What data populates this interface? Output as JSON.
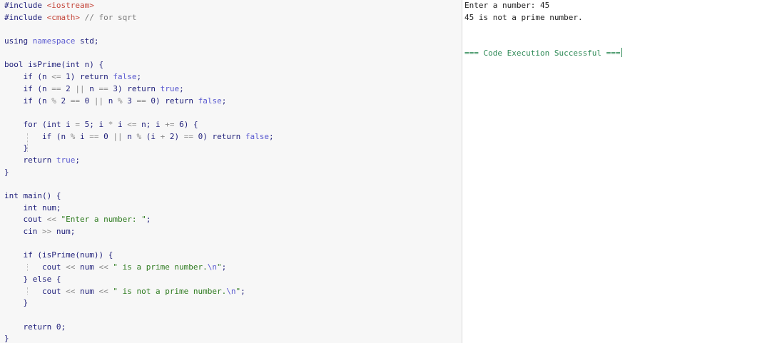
{
  "theme": {
    "editor_bg": "#f7f7f7",
    "output_bg": "#ffffff",
    "plain": "#1f1f7a",
    "keyword": "#1f1f7a",
    "preprocessor": "#1f1f7a",
    "header": "#c4463a",
    "comment": "#7a7a7a",
    "string": "#2d7a1e",
    "literal": "#5a5ad0",
    "operator": "#8a8a8a",
    "success": "#2f8a57"
  },
  "editor": {
    "lines": [
      [
        {
          "t": "#include ",
          "c": "preprocessor"
        },
        {
          "t": "<iostream>",
          "c": "header"
        }
      ],
      [
        {
          "t": "#include ",
          "c": "preprocessor"
        },
        {
          "t": "<cmath>",
          "c": "header"
        },
        {
          "t": " // for sqrt",
          "c": "comment"
        }
      ],
      [],
      [
        {
          "t": "using ",
          "c": "keyword"
        },
        {
          "t": "namespace ",
          "c": "literal"
        },
        {
          "t": "std;",
          "c": "plain"
        }
      ],
      [],
      [
        {
          "t": "bool ",
          "c": "keyword"
        },
        {
          "t": "isPrime(",
          "c": "plain"
        },
        {
          "t": "int ",
          "c": "keyword"
        },
        {
          "t": "n) {",
          "c": "plain"
        }
      ],
      [
        {
          "t": "    if ",
          "c": "keyword"
        },
        {
          "t": "(n ",
          "c": "plain"
        },
        {
          "t": "<=",
          "c": "operator"
        },
        {
          "t": " 1) ",
          "c": "plain"
        },
        {
          "t": "return ",
          "c": "keyword"
        },
        {
          "t": "false",
          "c": "literal"
        },
        {
          "t": ";",
          "c": "plain"
        }
      ],
      [
        {
          "t": "    if ",
          "c": "keyword"
        },
        {
          "t": "(n ",
          "c": "plain"
        },
        {
          "t": "==",
          "c": "operator"
        },
        {
          "t": " 2 ",
          "c": "plain"
        },
        {
          "t": "||",
          "c": "operator"
        },
        {
          "t": " n ",
          "c": "plain"
        },
        {
          "t": "==",
          "c": "operator"
        },
        {
          "t": " 3) ",
          "c": "plain"
        },
        {
          "t": "return ",
          "c": "keyword"
        },
        {
          "t": "true",
          "c": "literal"
        },
        {
          "t": ";",
          "c": "plain"
        }
      ],
      [
        {
          "t": "    if ",
          "c": "keyword"
        },
        {
          "t": "(n ",
          "c": "plain"
        },
        {
          "t": "%",
          "c": "operator"
        },
        {
          "t": " 2 ",
          "c": "plain"
        },
        {
          "t": "==",
          "c": "operator"
        },
        {
          "t": " 0 ",
          "c": "plain"
        },
        {
          "t": "||",
          "c": "operator"
        },
        {
          "t": " n ",
          "c": "plain"
        },
        {
          "t": "%",
          "c": "operator"
        },
        {
          "t": " 3 ",
          "c": "plain"
        },
        {
          "t": "==",
          "c": "operator"
        },
        {
          "t": " 0) ",
          "c": "plain"
        },
        {
          "t": "return ",
          "c": "keyword"
        },
        {
          "t": "false",
          "c": "literal"
        },
        {
          "t": ";",
          "c": "plain"
        }
      ],
      [],
      [
        {
          "t": "    for ",
          "c": "keyword"
        },
        {
          "t": "(",
          "c": "plain"
        },
        {
          "t": "int ",
          "c": "keyword"
        },
        {
          "t": "i ",
          "c": "plain"
        },
        {
          "t": "=",
          "c": "operator"
        },
        {
          "t": " 5; i ",
          "c": "plain"
        },
        {
          "t": "*",
          "c": "operator"
        },
        {
          "t": " i ",
          "c": "plain"
        },
        {
          "t": "<=",
          "c": "operator"
        },
        {
          "t": " n; i ",
          "c": "plain"
        },
        {
          "t": "+=",
          "c": "operator"
        },
        {
          "t": " 6) {",
          "c": "plain"
        }
      ],
      [
        {
          "t": "        if ",
          "c": "keyword"
        },
        {
          "t": "(n ",
          "c": "plain"
        },
        {
          "t": "%",
          "c": "operator"
        },
        {
          "t": " i ",
          "c": "plain"
        },
        {
          "t": "==",
          "c": "operator"
        },
        {
          "t": " 0 ",
          "c": "plain"
        },
        {
          "t": "||",
          "c": "operator"
        },
        {
          "t": " n ",
          "c": "plain"
        },
        {
          "t": "%",
          "c": "operator"
        },
        {
          "t": " (i ",
          "c": "plain"
        },
        {
          "t": "+",
          "c": "operator"
        },
        {
          "t": " 2) ",
          "c": "plain"
        },
        {
          "t": "==",
          "c": "operator"
        },
        {
          "t": " 0) ",
          "c": "plain"
        },
        {
          "t": "return ",
          "c": "keyword"
        },
        {
          "t": "false",
          "c": "literal"
        },
        {
          "t": ";",
          "c": "plain"
        }
      ],
      [
        {
          "t": "    }",
          "c": "plain"
        }
      ],
      [
        {
          "t": "    return ",
          "c": "keyword"
        },
        {
          "t": "true",
          "c": "literal"
        },
        {
          "t": ";",
          "c": "plain"
        }
      ],
      [
        {
          "t": "}",
          "c": "plain"
        }
      ],
      [],
      [
        {
          "t": "int ",
          "c": "keyword"
        },
        {
          "t": "main() {",
          "c": "plain"
        }
      ],
      [
        {
          "t": "    int ",
          "c": "keyword"
        },
        {
          "t": "num;",
          "c": "plain"
        }
      ],
      [
        {
          "t": "    cout ",
          "c": "plain"
        },
        {
          "t": "<<",
          "c": "operator"
        },
        {
          "t": " ",
          "c": "plain"
        },
        {
          "t": "\"Enter a number: \"",
          "c": "string"
        },
        {
          "t": ";",
          "c": "plain"
        }
      ],
      [
        {
          "t": "    cin ",
          "c": "plain"
        },
        {
          "t": ">>",
          "c": "operator"
        },
        {
          "t": " num;",
          "c": "plain"
        }
      ],
      [],
      [
        {
          "t": "    if ",
          "c": "keyword"
        },
        {
          "t": "(isPrime(num)) {",
          "c": "plain"
        }
      ],
      [
        {
          "t": "        cout ",
          "c": "plain"
        },
        {
          "t": "<<",
          "c": "operator"
        },
        {
          "t": " num ",
          "c": "plain"
        },
        {
          "t": "<<",
          "c": "operator"
        },
        {
          "t": " ",
          "c": "plain"
        },
        {
          "t": "\" is a prime number.",
          "c": "string"
        },
        {
          "t": "\\n",
          "c": "literal"
        },
        {
          "t": "\"",
          "c": "string"
        },
        {
          "t": ";",
          "c": "plain"
        }
      ],
      [
        {
          "t": "    } ",
          "c": "plain"
        },
        {
          "t": "else ",
          "c": "keyword"
        },
        {
          "t": "{",
          "c": "plain"
        }
      ],
      [
        {
          "t": "        cout ",
          "c": "plain"
        },
        {
          "t": "<<",
          "c": "operator"
        },
        {
          "t": " num ",
          "c": "plain"
        },
        {
          "t": "<<",
          "c": "operator"
        },
        {
          "t": " ",
          "c": "plain"
        },
        {
          "t": "\" is not a prime number.",
          "c": "string"
        },
        {
          "t": "\\n",
          "c": "literal"
        },
        {
          "t": "\"",
          "c": "string"
        },
        {
          "t": ";",
          "c": "plain"
        }
      ],
      [
        {
          "t": "    }",
          "c": "plain"
        }
      ],
      [],
      [
        {
          "t": "    return ",
          "c": "keyword"
        },
        {
          "t": "0;",
          "c": "plain"
        }
      ],
      [
        {
          "t": "}",
          "c": "plain"
        }
      ]
    ]
  },
  "output": {
    "lines": [
      {
        "text": "Enter a number: 45",
        "kind": "normal"
      },
      {
        "text": "45 is not a prime number.",
        "kind": "normal"
      },
      {
        "text": "",
        "kind": "normal"
      },
      {
        "text": "",
        "kind": "normal"
      },
      {
        "text": "=== Code Execution Successful ===",
        "kind": "success"
      }
    ]
  }
}
